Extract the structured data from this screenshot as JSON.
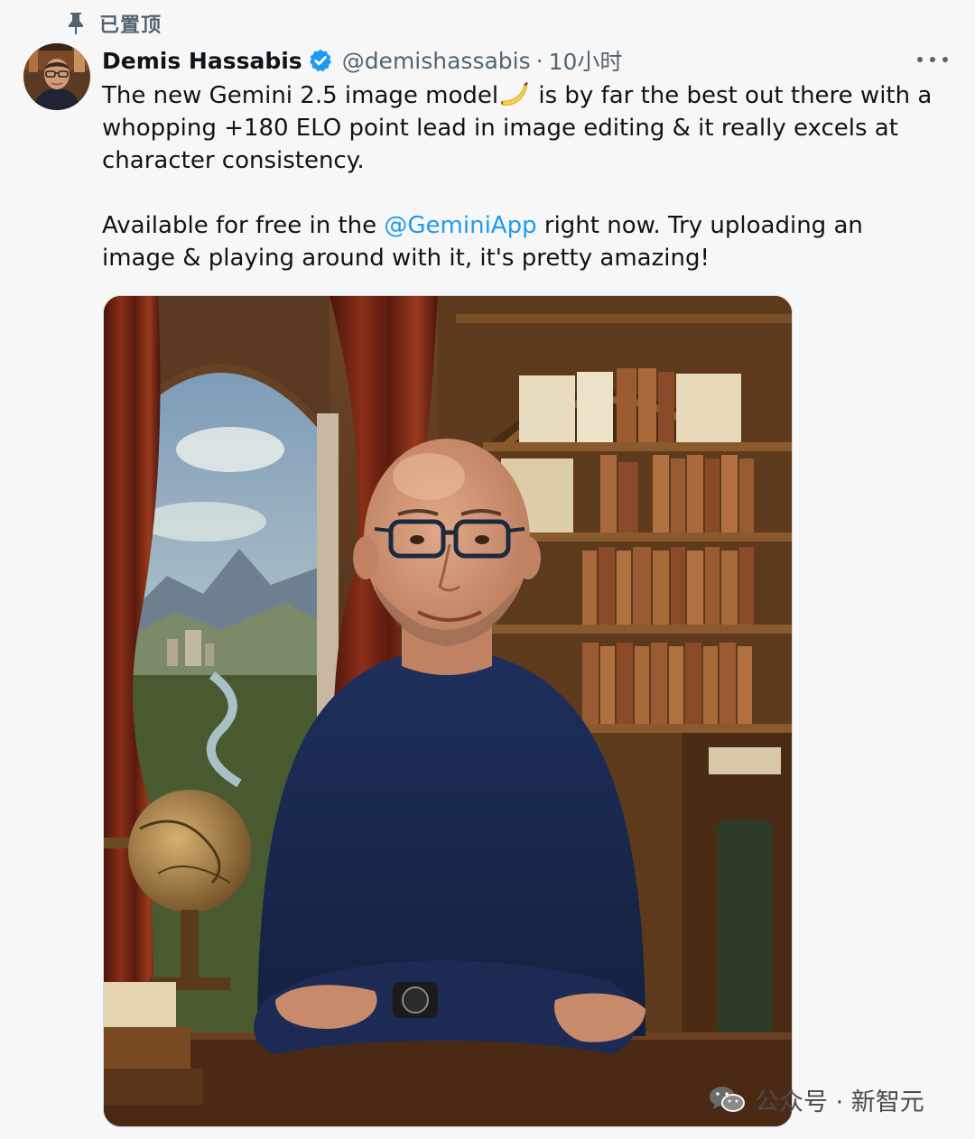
{
  "pinned": {
    "label": "已置顶"
  },
  "author": {
    "name": "Demis Hassabis",
    "handle": "@demishassabis",
    "separator": "·",
    "time": "10小时"
  },
  "tweet": {
    "line1_before": "The new Gemini 2.5 image model",
    "line1_after": " is by far the best out there with a whopping +180 ELO point lead in image editing & it really excels at character consistency.",
    "para2_before": "Available for free in the ",
    "mention": "@GeminiApp",
    "para2_after": " right now. Try uploading an image & playing around with it, it's pretty amazing!"
  },
  "watermark": {
    "text": "公众号 · 新智元"
  },
  "colors": {
    "link": "#1d9bf0",
    "verified": "#1d9bf0",
    "secondary_text": "#536471",
    "background": "#f7f7f7"
  },
  "icons": {
    "pin": "pin-icon",
    "verified": "verified-badge-icon",
    "more": "more-horizontal-icon",
    "emoji": "banana-emoji",
    "watermark": "wechat-icon"
  }
}
